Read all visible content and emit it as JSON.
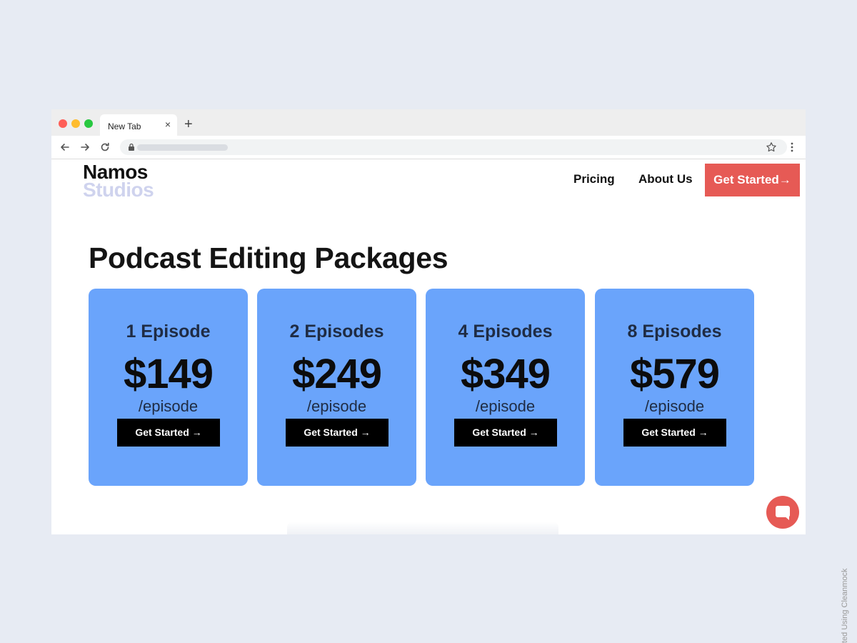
{
  "browser": {
    "tab_title": "New Tab",
    "tab_close": "×",
    "new_tab": "+"
  },
  "header": {
    "logo_line1": "Namos",
    "logo_line2": "Studios",
    "nav": [
      "Pricing",
      "About Us"
    ],
    "cta": "Get Started→"
  },
  "main": {
    "title": "Podcast Editing Packages",
    "packages": [
      {
        "name": "1 Episode",
        "price": "$149",
        "unit": "/episode",
        "button": "Get Started →"
      },
      {
        "name": "2 Episodes",
        "price": "$249",
        "unit": "/episode",
        "button": "Get Started →"
      },
      {
        "name": "4 Episodes",
        "price": "$349",
        "unit": "/episode",
        "button": "Get Started →"
      },
      {
        "name": "8 Episodes",
        "price": "$579",
        "unit": "/episode",
        "button": "Get Started →"
      }
    ]
  },
  "icons": {
    "back": "back-arrow-icon",
    "forward": "forward-arrow-icon",
    "reload": "reload-icon",
    "lock": "lock-icon",
    "bookmark": "star-icon",
    "menu": "more-vert-icon",
    "chat": "chat-bubble-icon"
  },
  "colors": {
    "card": "#6aa4fb",
    "accent": "#e65a55",
    "logo_secondary": "#cfd3ee",
    "background": "#e7ebf3"
  },
  "watermark": "ted Using Cleanmock"
}
